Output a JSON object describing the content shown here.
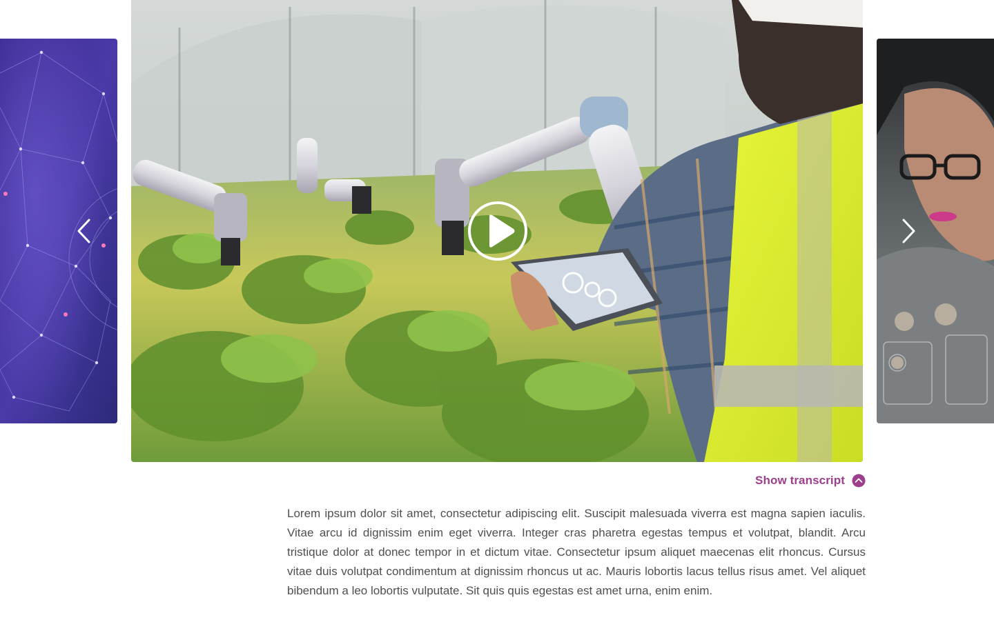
{
  "carousel": {
    "prev_slide": {
      "description_icon": "network-globe-image"
    },
    "main_slide": {
      "description_icon": "greenhouse-robot-image"
    },
    "next_slide": {
      "description_icon": "woman-with-glasses-image"
    },
    "prev_arrow_icon": "chevron-left-icon",
    "next_arrow_icon": "chevron-right-icon",
    "play_icon": "play-icon"
  },
  "transcript": {
    "toggle_label": "Show transcript",
    "toggle_icon": "chevron-up-circle-icon",
    "text": "Lorem ipsum dolor sit amet, consectetur adipiscing elit. Suscipit malesuada viverra est magna sapien iaculis. Vitae arcu id dignissim enim eget viverra. Integer cras pharetra egestas tempus et volutpat, blandit. Arcu tristique dolor at donec tempor in et dictum vitae. Consectetur ipsum aliquet maecenas elit rhoncus. Cursus vitae duis volutpat condimentum at dignissim rhoncus ut ac. Mauris lobortis lacus tellus risus amet. Vel aliquet bibendum a leo lobortis vulputate. Sit quis quis egestas est amet urna, enim enim."
  },
  "colors": {
    "accent": "#9c3f8c",
    "body_text": "#4f4f4f",
    "background": "#ffffff"
  }
}
